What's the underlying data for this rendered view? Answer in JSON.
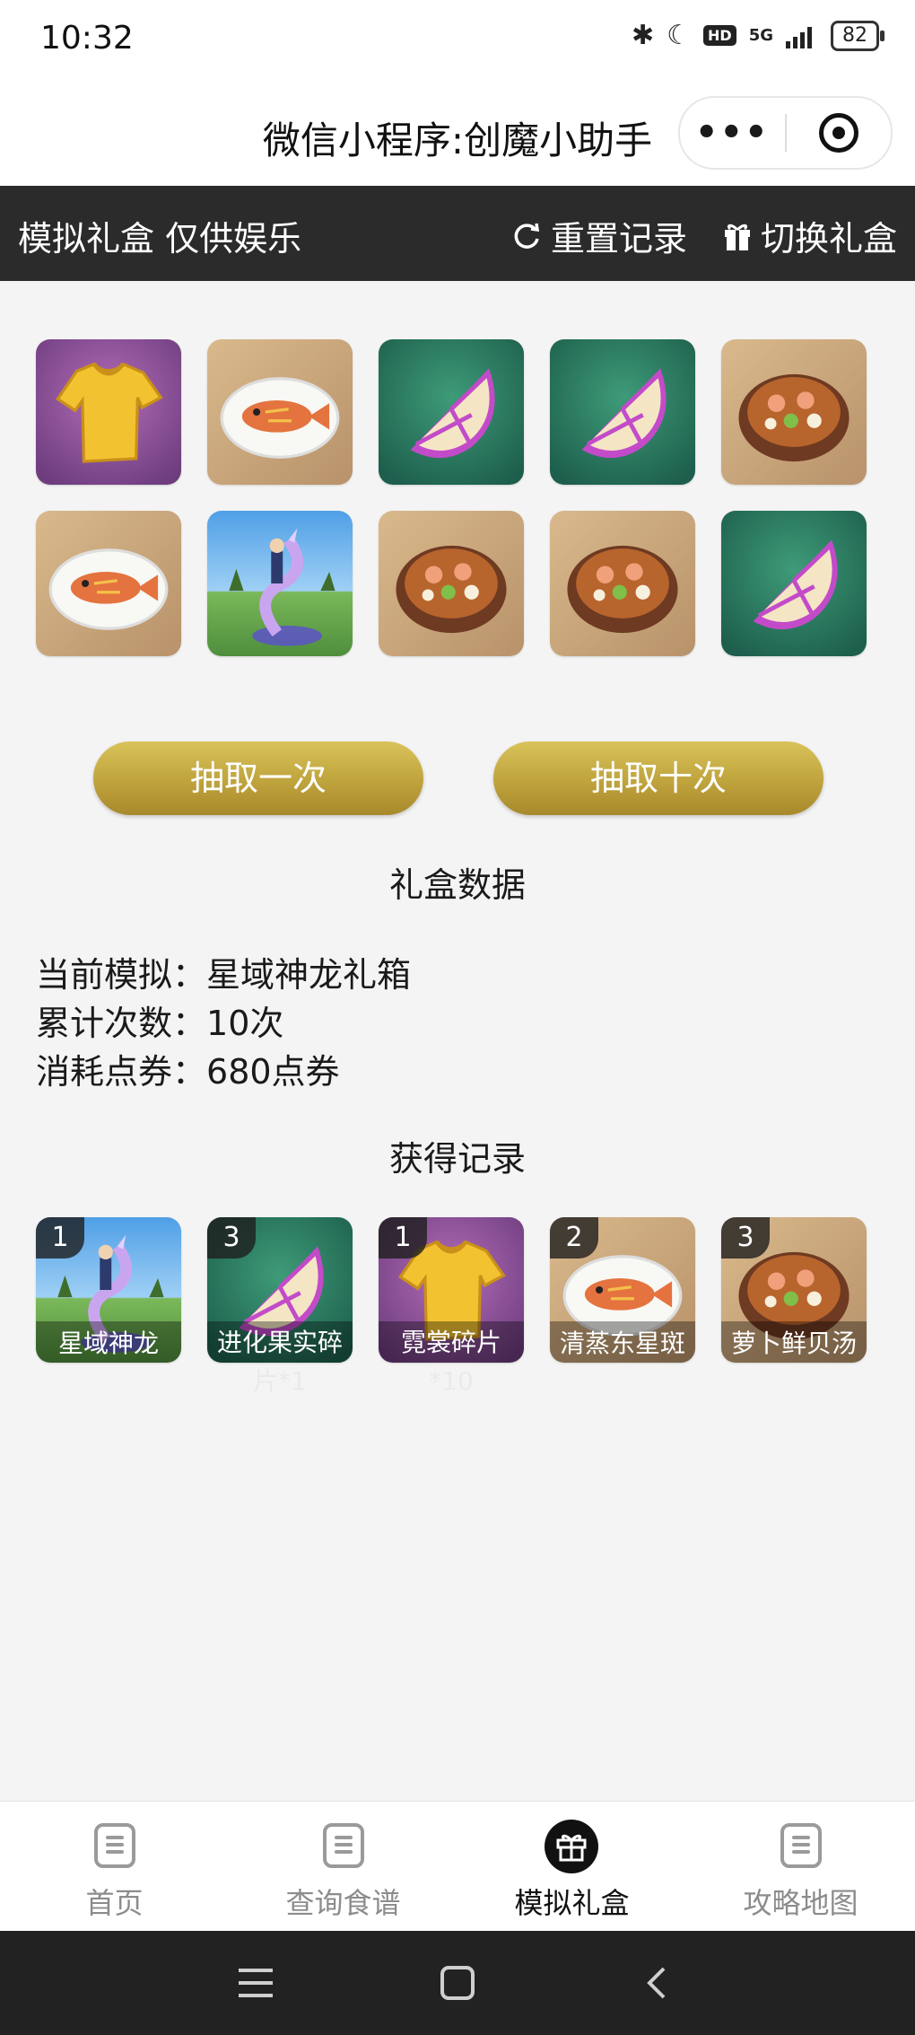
{
  "status_bar": {
    "time": "10:32",
    "network": "5G",
    "hd": "HD",
    "battery": "82"
  },
  "titlebar": {
    "title": "微信小程序:创魔小助手",
    "more": "•••"
  },
  "header": {
    "title": "模拟礼盒 仅供娱乐",
    "reset_label": "重置记录",
    "switch_label": "切换礼盒"
  },
  "draw_results": [
    {
      "item": "shirt-icon"
    },
    {
      "item": "fish-dish-icon"
    },
    {
      "item": "fruit-slice-icon"
    },
    {
      "item": "fruit-slice-icon"
    },
    {
      "item": "soup-bowl-icon"
    },
    {
      "item": "fish-dish-icon"
    },
    {
      "item": "dragon-mount-icon"
    },
    {
      "item": "soup-bowl-icon"
    },
    {
      "item": "soup-bowl-icon"
    },
    {
      "item": "fruit-slice-icon"
    }
  ],
  "buttons": {
    "draw_once": "抽取一次",
    "draw_ten": "抽取十次"
  },
  "stats": {
    "title": "礼盒数据",
    "current_label": "当前模拟：",
    "current_value": "星域神龙礼箱",
    "count_label": "累计次数：",
    "count_value": "10次",
    "cost_label": "消耗点券：",
    "cost_value": "680点券"
  },
  "records": {
    "title": "获得记录",
    "items": [
      {
        "count": "1",
        "name": "星域神龙",
        "extra": ""
      },
      {
        "count": "3",
        "name": "进化果实碎",
        "extra": "片*1"
      },
      {
        "count": "1",
        "name": "霓裳碎片",
        "extra": "*10"
      },
      {
        "count": "2",
        "name": "清蒸东星斑",
        "extra": ""
      },
      {
        "count": "3",
        "name": "萝卜鲜贝汤",
        "extra": ""
      }
    ]
  },
  "tabs": [
    {
      "label": "首页"
    },
    {
      "label": "查询食谱"
    },
    {
      "label": "模拟礼盒"
    },
    {
      "label": "攻略地图"
    }
  ],
  "colors": {
    "dark_bar": "#2b2b2b",
    "gold": "#c4a845",
    "background": "#f4f4f4"
  }
}
